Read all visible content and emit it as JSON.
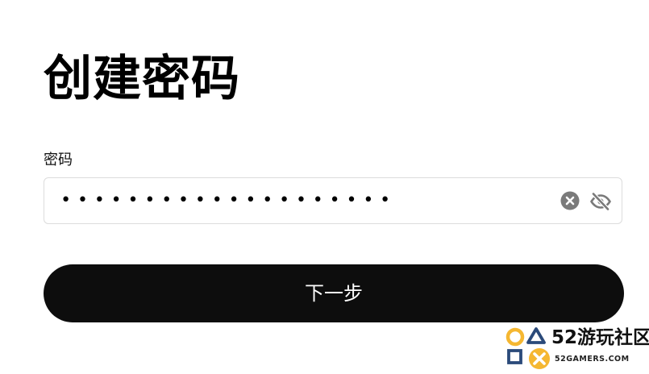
{
  "page": {
    "title": "创建密码"
  },
  "password_field": {
    "label": "密码",
    "masked_value": "••••••••••••••••••••",
    "clear_icon": "clear-circle-x-icon",
    "visibility_icon": "eye-slash-icon"
  },
  "actions": {
    "next_label": "下一步"
  },
  "watermark": {
    "title": "52游玩社区",
    "subtitle": "52GAMERS.COM"
  },
  "colors": {
    "button_bg": "#0d0d0d",
    "button_text": "#ffffff",
    "input_border": "#dcdcdc",
    "icon_gray": "#7a7a7a",
    "watermark_yellow": "#f5b731",
    "watermark_blue": "#2b4a7a"
  }
}
